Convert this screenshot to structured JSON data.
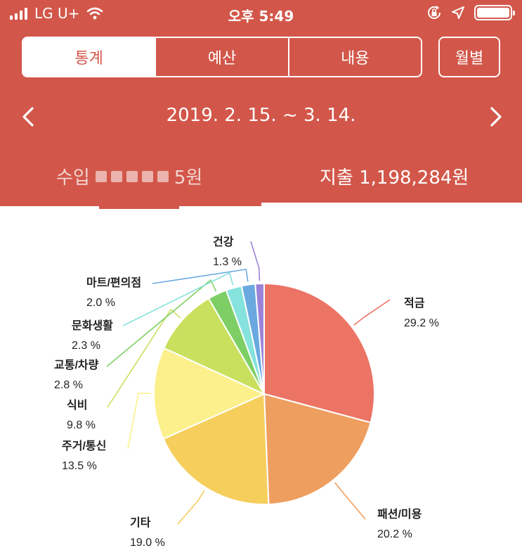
{
  "status_bar": {
    "carrier": "LG U+",
    "time": "오후 5:49",
    "icons": [
      "signal-bars-icon",
      "wifi-icon",
      "orientation-lock-icon",
      "location-arrow-icon",
      "battery-icon"
    ]
  },
  "tabs": [
    {
      "label": "통계",
      "active": true
    },
    {
      "label": "예산",
      "active": false
    },
    {
      "label": "내용",
      "active": false
    }
  ],
  "monthly_button": "월별",
  "date_range": "2019. 2. 15. ~ 3. 14.",
  "summary": {
    "income_label": "수입",
    "income_value_suffix": "5원",
    "expense_label": "지출",
    "expense_value": "1,198,284원"
  },
  "colors": {
    "header": "#d2574a",
    "text_on_header": "#ffffff"
  },
  "chart_data": {
    "type": "pie",
    "series": [
      {
        "values": [
          {
            "label": "적금",
            "pct_text": "29.2 %",
            "value": 29.2,
            "color": "#ec7465"
          },
          {
            "label": "패션/미용",
            "pct_text": "20.2 %",
            "value": 20.2,
            "color": "#ee9e5e"
          },
          {
            "label": "기타",
            "pct_text": "19.0 %",
            "value": 19.0,
            "color": "#f5ce5c"
          },
          {
            "label": "주거/통신",
            "pct_text": "13.5 %",
            "value": 13.5,
            "color": "#fbf08c"
          },
          {
            "label": "식비",
            "pct_text": "9.8 %",
            "value": 9.8,
            "color": "#c9e05e"
          },
          {
            "label": "교통/차량",
            "pct_text": "2.8 %",
            "value": 2.8,
            "color": "#7dcf65"
          },
          {
            "label": "문화생활",
            "pct_text": "2.3 %",
            "value": 2.3,
            "color": "#86e2dc"
          },
          {
            "label": "마트/편의점",
            "pct_text": "2.0 %",
            "value": 2.0,
            "color": "#6aa9e0"
          },
          {
            "label": "건강",
            "pct_text": "1.3 %",
            "value": 1.3,
            "color": "#9c83d8"
          }
        ]
      }
    ]
  }
}
